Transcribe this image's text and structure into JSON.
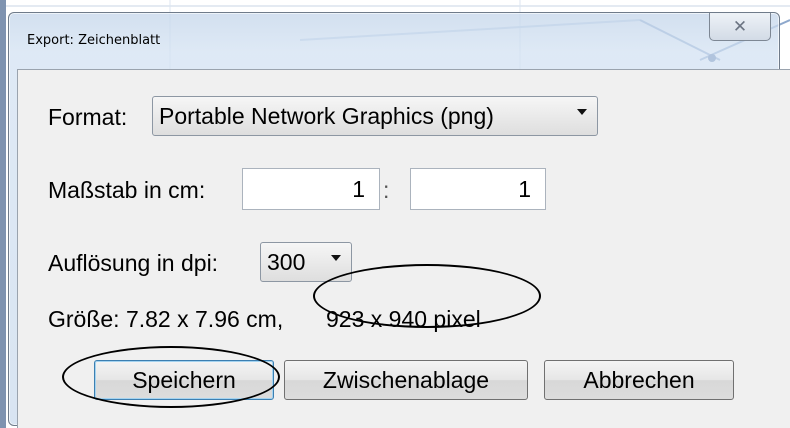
{
  "window": {
    "title": "Export: Zeichenblatt",
    "close_symbol": "✕"
  },
  "format": {
    "label": "Format:",
    "selected": "Portable Network Graphics (png)"
  },
  "scale": {
    "label": "Maßstab in cm:",
    "left_value": "1",
    "separator": ":",
    "right_value": "1"
  },
  "resolution": {
    "label": "Auflösung in dpi:",
    "selected": "300"
  },
  "size": {
    "text_cm": "Größe: 7.82 x 7.96 cm,",
    "text_px": "923 x 940 pixel"
  },
  "buttons": {
    "save": "Speichern",
    "clipboard": "Zwischenablage",
    "cancel": "Abbrechen"
  },
  "icons": {
    "close": "close-icon",
    "dropdown": "chevron-down-icon"
  },
  "colors": {
    "window_frame": "#c6d7eb",
    "panel": "#f0f0f0",
    "default_button_border": "#3c7fb1"
  }
}
